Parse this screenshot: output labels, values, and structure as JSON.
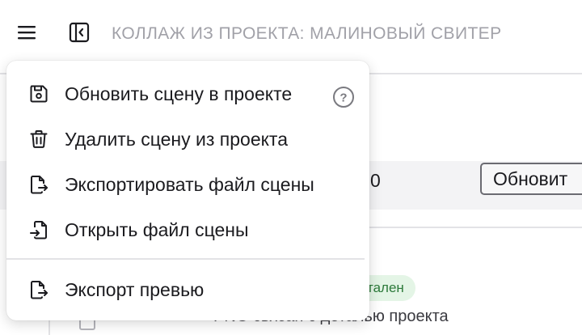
{
  "header": {
    "title": "КОЛЛАЖ ИЗ ПРОЕКТА: МАЛИНОВЫЙ СВИТЕР",
    "menu_icon": "hamburger-icon",
    "panel_icon": "sidebar-toggle-icon"
  },
  "background": {
    "row_value": "0",
    "row_button_label": "Обновит",
    "status_badge": "тален",
    "link_description": "PNG связан с деталью проекта"
  },
  "menu": {
    "items": [
      {
        "label": "Обновить сцену в проекте",
        "icon": "save-icon"
      },
      {
        "label": "Удалить сцену из проекта",
        "icon": "trash-icon"
      },
      {
        "label": "Экспортировать файл сцены",
        "icon": "file-export-icon"
      },
      {
        "label": "Открыть файл сцены",
        "icon": "file-import-icon"
      },
      {
        "label": "Экспорт превью",
        "icon": "file-export-icon"
      }
    ],
    "help_icon": "help-icon",
    "help_label": "?"
  },
  "colors": {
    "title": "#a1a1a8",
    "text": "#1b1b1f",
    "badge_bg": "#e4f5e6",
    "badge_text": "#2c7a3a",
    "divider": "#e3e3e6"
  }
}
